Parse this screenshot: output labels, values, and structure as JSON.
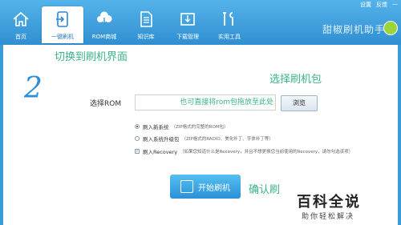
{
  "window": {
    "top_links": [
      "设置",
      "反馈",
      "—"
    ]
  },
  "nav": {
    "items": [
      {
        "label": "首页",
        "icon": "home-icon",
        "active": false
      },
      {
        "label": "一键刷机",
        "icon": "flash-phone-icon",
        "active": true
      },
      {
        "label": "ROM商城",
        "icon": "cloud-download-icon",
        "active": false
      },
      {
        "label": "知识库",
        "icon": "document-icon",
        "active": false
      },
      {
        "label": "下载管理",
        "icon": "download-manager-icon",
        "active": false
      },
      {
        "label": "实用工具",
        "icon": "tools-icon",
        "active": false
      }
    ],
    "brand": "甜椒刷机助手"
  },
  "annotations": {
    "switch_view": "切换到刷机界面",
    "step_number": "2",
    "choose_package": "选择刷机包",
    "confirm": "确认刷"
  },
  "rom": {
    "label": "选择ROM",
    "placeholder": "也可直接将rom包拖放至此处",
    "browse": "浏览"
  },
  "options": [
    {
      "label": "刷入新系统",
      "desc": "（ZIP格式的完整的ROM包）",
      "type": "radio",
      "checked": true
    },
    {
      "label": "刷入系统升级包",
      "desc": "（ZIP格式的RADIO、美化补丁、字体补丁等）",
      "type": "radio",
      "checked": false
    },
    {
      "label": "刷入Recovery",
      "desc": "（如果您知道什么是Recovery，并且不想更换您当前使用的Recovery，请勿勾选该项）",
      "type": "checkbox",
      "checked": true
    }
  ],
  "start_button": "开始刷机",
  "watermark": {
    "title": "百科全说",
    "subtitle": "助你轻松解决"
  }
}
